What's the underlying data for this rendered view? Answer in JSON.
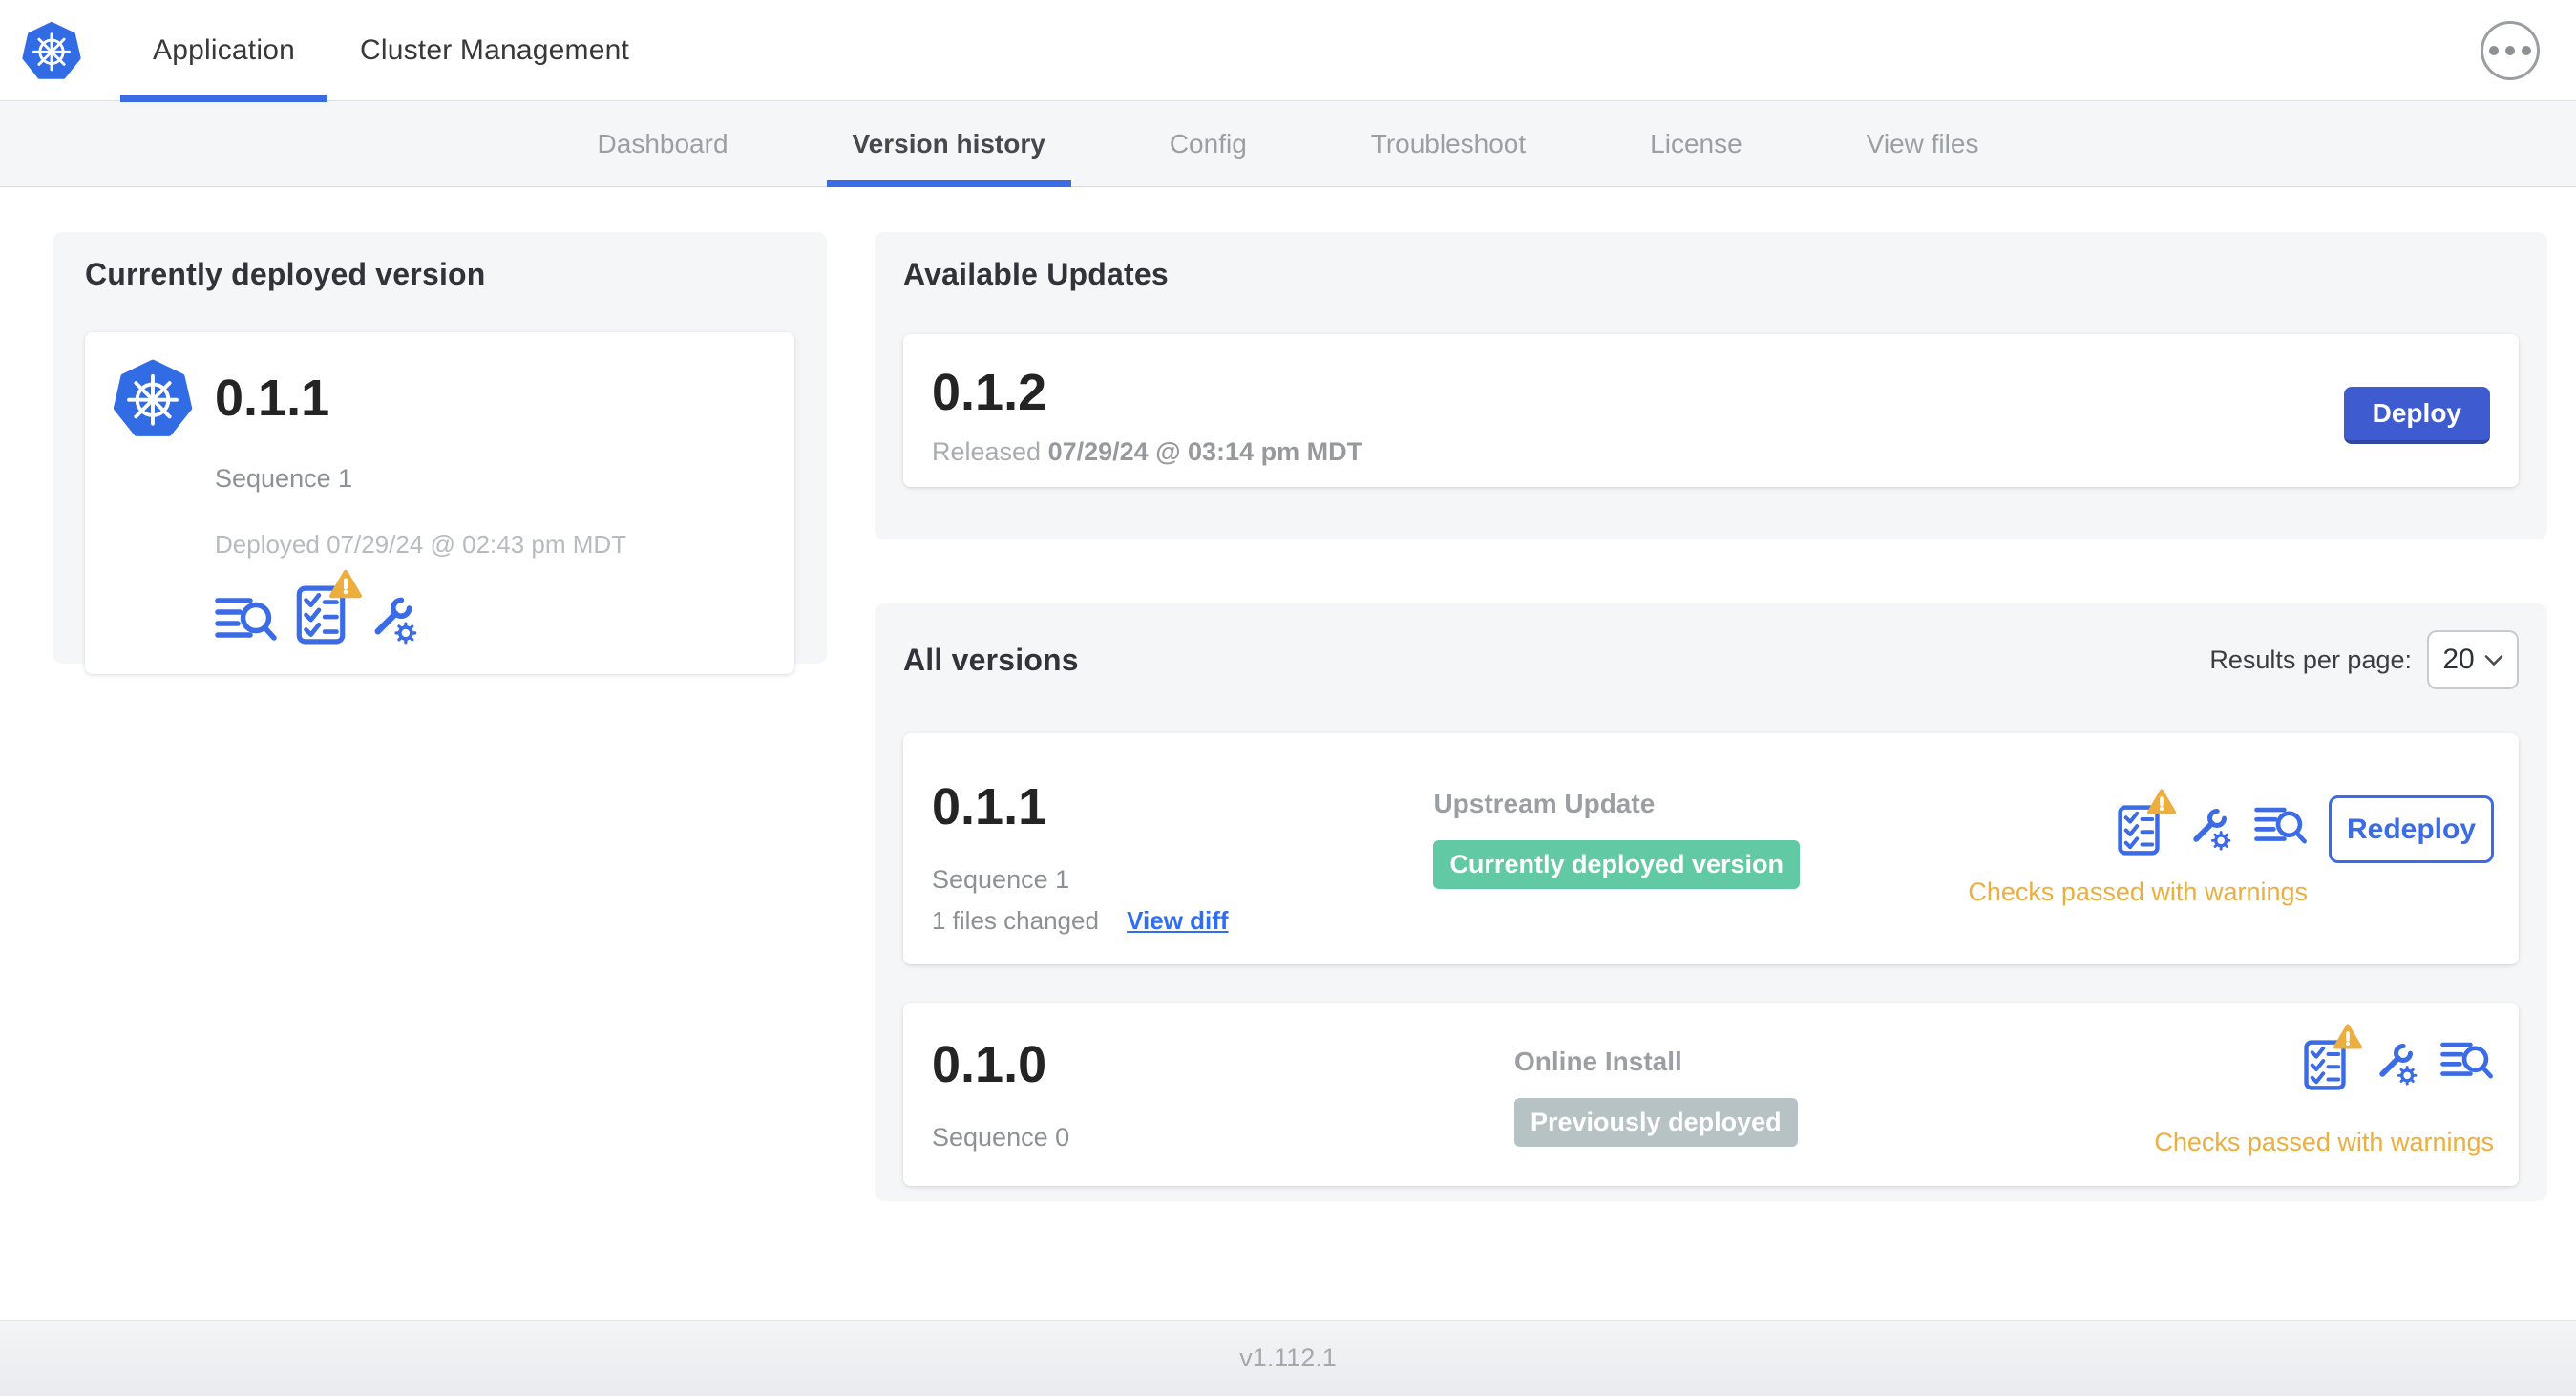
{
  "header": {
    "tabs": [
      {
        "label": "Application",
        "active": true
      },
      {
        "label": "Cluster Management",
        "active": false
      }
    ]
  },
  "subnav": {
    "tabs": [
      {
        "label": "Dashboard",
        "active": false
      },
      {
        "label": "Version history",
        "active": true
      },
      {
        "label": "Config",
        "active": false
      },
      {
        "label": "Troubleshoot",
        "active": false
      },
      {
        "label": "License",
        "active": false
      },
      {
        "label": "View files",
        "active": false
      }
    ]
  },
  "current_version": {
    "title": "Currently deployed version",
    "version": "0.1.1",
    "sequence": "Sequence 1",
    "deployed": "Deployed 07/29/24 @ 02:43 pm MDT"
  },
  "available_updates": {
    "title": "Available Updates",
    "version": "0.1.2",
    "released_label": "Released",
    "released_date": "07/29/24 @ 03:14 pm MDT",
    "deploy_label": "Deploy"
  },
  "all_versions": {
    "title": "All versions",
    "results_label": "Results per page:",
    "results_value": "20",
    "rows": [
      {
        "version": "0.1.1",
        "sequence": "Sequence 1",
        "files_changed": "1 files changed",
        "view_diff_label": "View diff",
        "source_type": "Upstream Update",
        "badge_label": "Currently deployed version",
        "status_text": "Checks passed with warnings",
        "action_label": "Redeploy"
      },
      {
        "version": "0.1.0",
        "sequence": "Sequence 0",
        "source_type": "Online Install",
        "badge_label": "Previously deployed",
        "status_text": "Checks passed with warnings"
      }
    ]
  },
  "footer": {
    "app_version": "v1.112.1"
  },
  "icons": {
    "logo": "kubernetes-logo",
    "menu": "ellipsis-menu",
    "diff": "file-diff-search",
    "preflight": "preflight-checklist",
    "preflight_warning": "warning-triangle",
    "config": "wrench-gear",
    "select_chevron": "chevron-down"
  },
  "colors": {
    "k8s_blue": "#326CE5",
    "accent_blue": "#3B6CE5",
    "button_blue": "#3E5CD0",
    "link_blue": "#2F6DF2",
    "success_green": "#61C9A3",
    "muted_badge_gray": "#B6C2C4",
    "warning_amber": "#ECAE3E"
  }
}
